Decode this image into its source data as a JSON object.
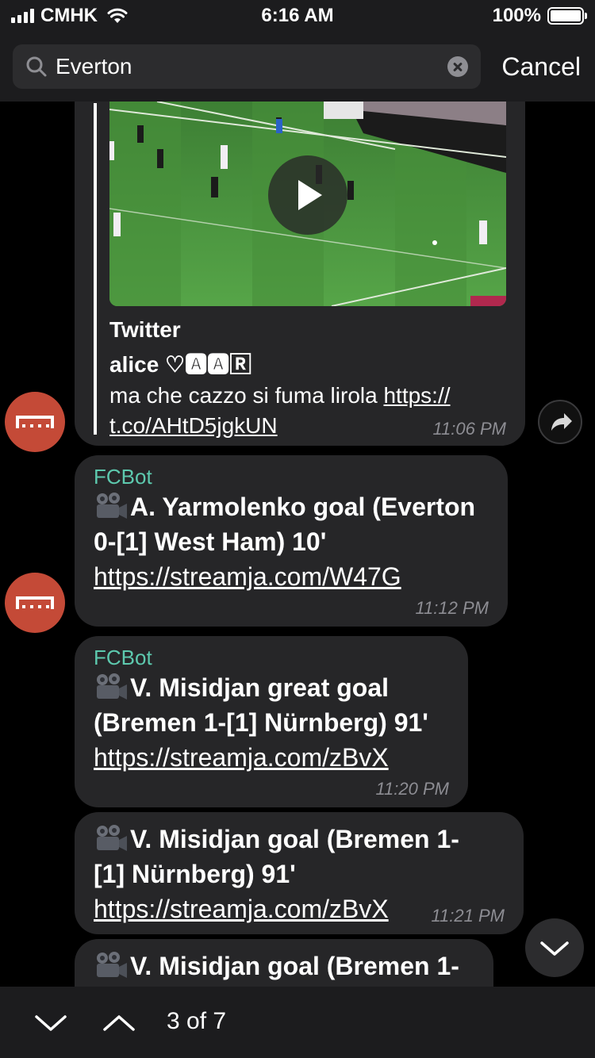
{
  "status_bar": {
    "carrier": "CMHK",
    "time": "6:16 AM",
    "battery": "100%"
  },
  "search": {
    "query": "Everton",
    "cancel_label": "Cancel"
  },
  "messages": [
    {
      "source": "Twitter",
      "author": "alice ♡🅰🅰🅁",
      "text": "ma che cazzo si fuma lirola",
      "link_line1": "https://",
      "link_line2": "t.co/AHtD5jgkUN",
      "time": "11:06 PM"
    },
    {
      "sender": "FCBot",
      "line1": "A. Yarmolenko goal (Everton",
      "line2": "0-[1] West Ham) 10'",
      "link": "https://streamja.com/W47G",
      "time": "11:12 PM"
    },
    {
      "sender": "FCBot",
      "line1": "V. Misidjan great goal",
      "line2": "(Bremen 1-[1] Nürnberg) 91'",
      "link": "https://streamja.com/zBvX",
      "time": "11:20 PM"
    },
    {
      "line1": "V. Misidjan goal (Bremen 1-",
      "line2": "[1] Nürnberg) 91'",
      "link": "https://streamja.com/zBvX",
      "time": "11:21 PM"
    },
    {
      "line1": "V. Misidjan goal (Bremen 1-"
    }
  ],
  "bottom_bar": {
    "counter": "3 of 7"
  },
  "colors": {
    "background": "#000000",
    "bubble": "#262628",
    "sender_name": "#5dc9ae",
    "avatar": "#c44a37",
    "bars": "#1c1c1e"
  }
}
